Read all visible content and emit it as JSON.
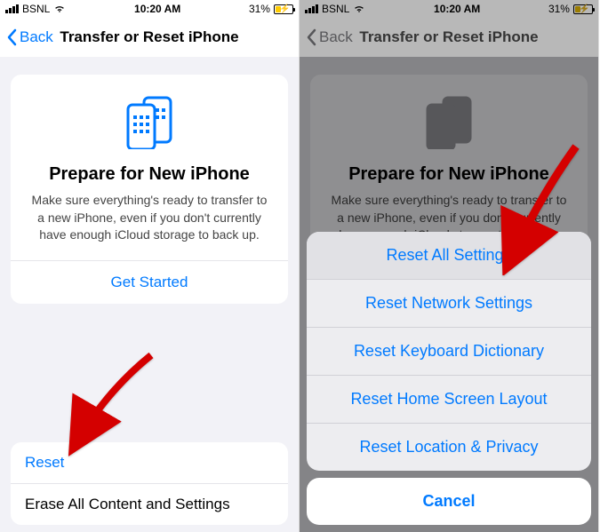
{
  "status": {
    "carrier": "BSNL",
    "time": "10:20 AM",
    "battery_pct": "31%"
  },
  "nav": {
    "back": "Back",
    "title": "Transfer or Reset iPhone"
  },
  "card": {
    "title": "Prepare for New iPhone",
    "text": "Make sure everything's ready to transfer to a new iPhone, even if you don't currently have enough iCloud storage to back up.",
    "action": "Get Started"
  },
  "bottom": {
    "reset": "Reset",
    "erase": "Erase All Content and Settings"
  },
  "sheet": {
    "options": [
      "Reset All Settings",
      "Reset Network Settings",
      "Reset Keyboard Dictionary",
      "Reset Home Screen Layout",
      "Reset Location & Privacy"
    ],
    "cancel": "Cancel"
  }
}
